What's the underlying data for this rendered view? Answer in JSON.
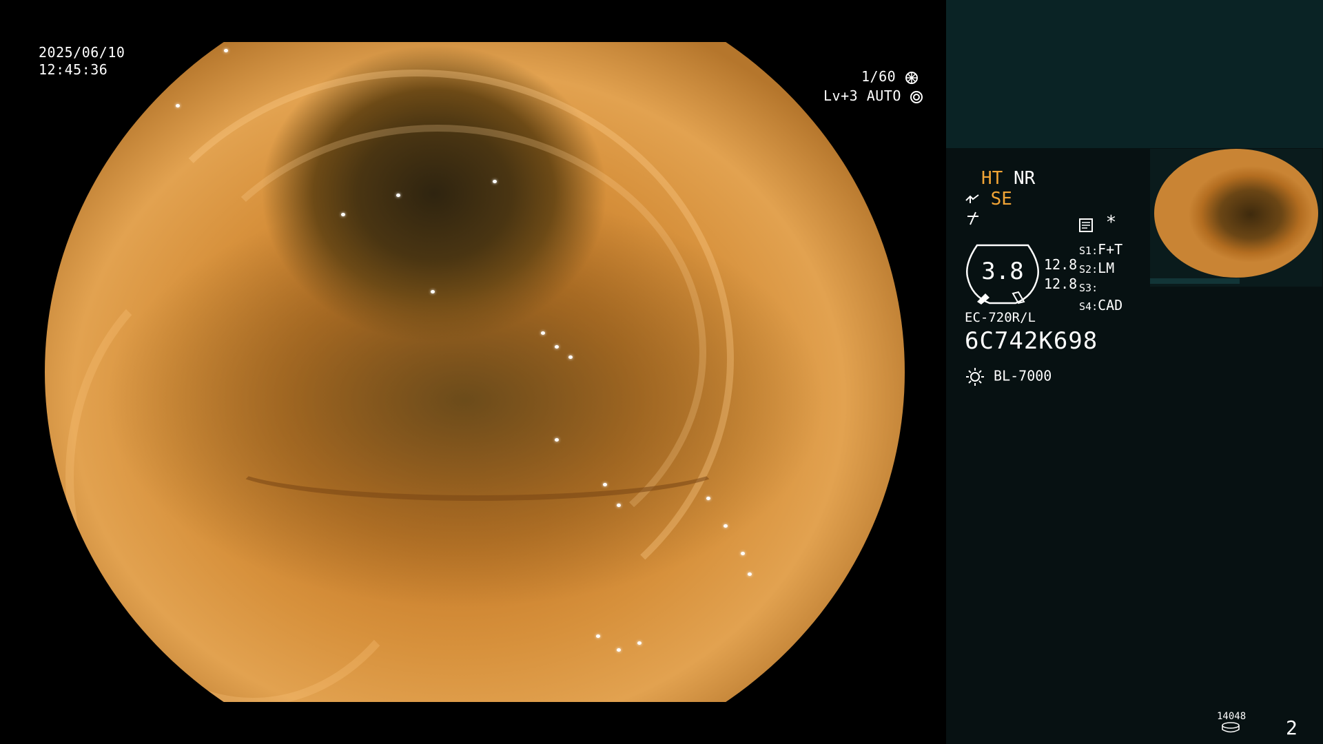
{
  "datetime": {
    "date": "2025/06/10",
    "time": "12:45:36"
  },
  "exposure": {
    "shutter": "1/60",
    "level": "Lv+3",
    "mode": "AUTO"
  },
  "indicators": {
    "ht": "HT",
    "nr": "NR",
    "se": "SE",
    "asterisk": "*"
  },
  "gauge": {
    "value": "3.8"
  },
  "settings": {
    "values": [
      "12.8",
      "12.8"
    ],
    "slots": [
      {
        "key": "S1",
        "value": "F+T"
      },
      {
        "key": "S2",
        "value": "LM"
      },
      {
        "key": "S3",
        "value": ""
      },
      {
        "key": "S4",
        "value": "CAD"
      }
    ]
  },
  "scope": {
    "model": "EC-720R/L",
    "serial": "6C742K698"
  },
  "light": {
    "model": "BL-7000"
  },
  "storage": {
    "count": "14048",
    "page": "2"
  },
  "icons": [
    "shutter-icon",
    "iris-icon",
    "scope-icon",
    "dashed-icon",
    "memo-icon",
    "light-icon",
    "disk-icon"
  ],
  "colors": {
    "accent": "#f2a536",
    "panel": "#071112",
    "panel_top": "#0a2325"
  }
}
